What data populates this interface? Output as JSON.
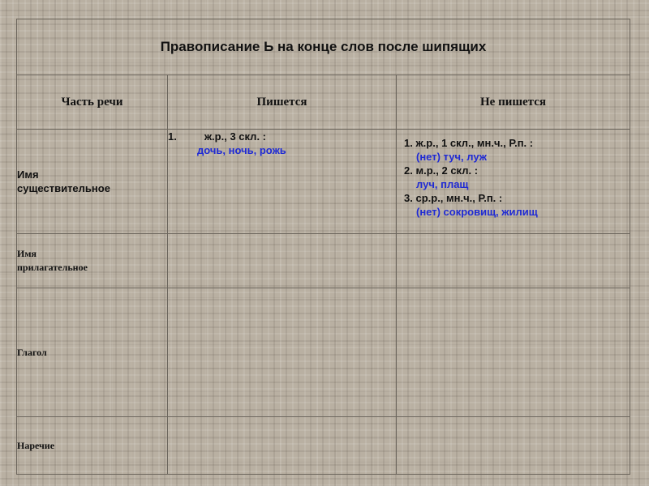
{
  "title": "Правописание Ь на конце слов после шипящих",
  "headers": {
    "col1": "Часть речи",
    "col2": "Пишется",
    "col3": "Не пишется"
  },
  "rows": [
    {
      "label_line1": "Имя",
      "label_line2": "существительное",
      "pishetsya": {
        "number": "1.",
        "rule": "ж.р., 3 скл. :",
        "example": "дочь, ночь, рожь"
      },
      "ne_pishetsya": [
        {
          "number": "1.",
          "rule": "ж.р., 1 скл., мн.ч.,  Р.п. :",
          "example": "(нет) туч, луж"
        },
        {
          "number": "2.",
          "rule": "м.р., 2 скл. :",
          "example": "луч, плащ"
        },
        {
          "number": "3.",
          "rule": "ср.р., мн.ч.,  Р.п. :",
          "example": "(нет) сокровищ, жилищ"
        }
      ]
    },
    {
      "label_line1": "Имя",
      "label_line2": "прилагательное"
    },
    {
      "label_line1": "Глагол"
    },
    {
      "label_line1": "Наречие"
    }
  ],
  "colors": {
    "example_text": "#1f2ad4",
    "border": "#6b655c",
    "background": "#b9b0a2"
  }
}
